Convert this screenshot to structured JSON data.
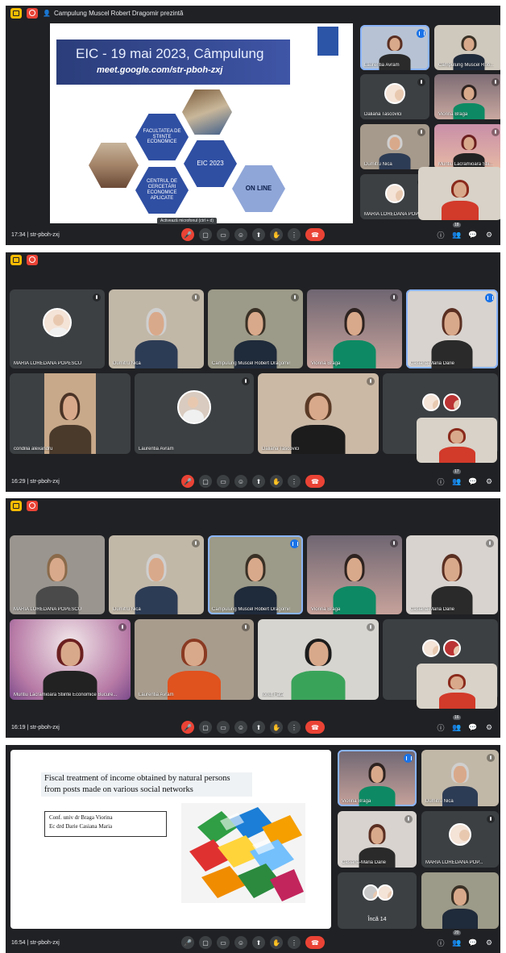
{
  "colors": {
    "bg": "#202124",
    "tile": "#3c4043",
    "accent": "#8ab4f8",
    "danger": "#ea4335",
    "present": "#fbbc04"
  },
  "meeting_code": "str-pboh-zxj",
  "screens": [
    {
      "presenting_label": "Campulung Muscel Robert Dragomir prezintă",
      "time": "17:34",
      "tooltip": "Activează microfonul (ctrl + d)",
      "participants_badge": "18",
      "slide": {
        "title": "EIC - 19 mai 2023, Câmpulung",
        "link": "meet.google.com/str-pboh-zxj",
        "hex1": "FACULTATEA DE ȘTIINȚE ECONOMICE",
        "hex2": "EIC 2023",
        "hex3": "CENTRUL DE CERCETĂRI ECONOMICE APLICATE",
        "hex4": "ON LINE"
      },
      "tiles": [
        "Laurentia Avram",
        "Campulung Muscel Rob...",
        "Daliana Tascovici",
        "Viorina Braga",
        "Dumitru Nica",
        "Muntiu Lacramioara Stii...",
        "MARIA LOREDANA POP..."
      ]
    },
    {
      "time": "16:29",
      "participants_badge": "17",
      "tiles": [
        "MARIA LOREDANA POPESCU",
        "Dumitru Nica",
        "Campulung Muscel Robert Dragomir",
        "Viorina Braga",
        "Casiana-Maria Darie",
        "condilia alexandru",
        "Laurentia Avram",
        "Daliana Tascovici"
      ]
    },
    {
      "time": "16:19",
      "participants_badge": "16",
      "tiles": [
        "MARIA LOREDANA POPESCU",
        "Dumitru Nica",
        "Campulung Muscel Robert Dragomir",
        "Viorina Braga",
        "Casiana-Maria Darie",
        "Muntiu Lacramioara Stiinte Economice Bucure...",
        "Laurentia Avram",
        "Ionuț Fațâ"
      ]
    },
    {
      "time": "16:54",
      "participants_badge": "20",
      "slide": {
        "title_line1": "Fiscal treatment of income obtained by natural persons",
        "title_line2": "from posts made on various social networks",
        "author1": "Conf. univ dr Braga Viorina",
        "author2": "Ec drd Darie Casiana Maria"
      },
      "tiles": [
        "Viorina Braga",
        "Dumitru Nica",
        "Casiana-Maria Darie",
        "MARIA LOREDANA POP...",
        "Încă 14"
      ]
    }
  ],
  "icons": {
    "mic": "🎤",
    "cam": "▢",
    "cc": "▭",
    "emoji": "☺",
    "present": "⬆",
    "hand": "✋",
    "more": "⋮",
    "end": "☎",
    "info": "ⓘ",
    "people": "👥",
    "chat": "💬",
    "activities": "⚙"
  }
}
